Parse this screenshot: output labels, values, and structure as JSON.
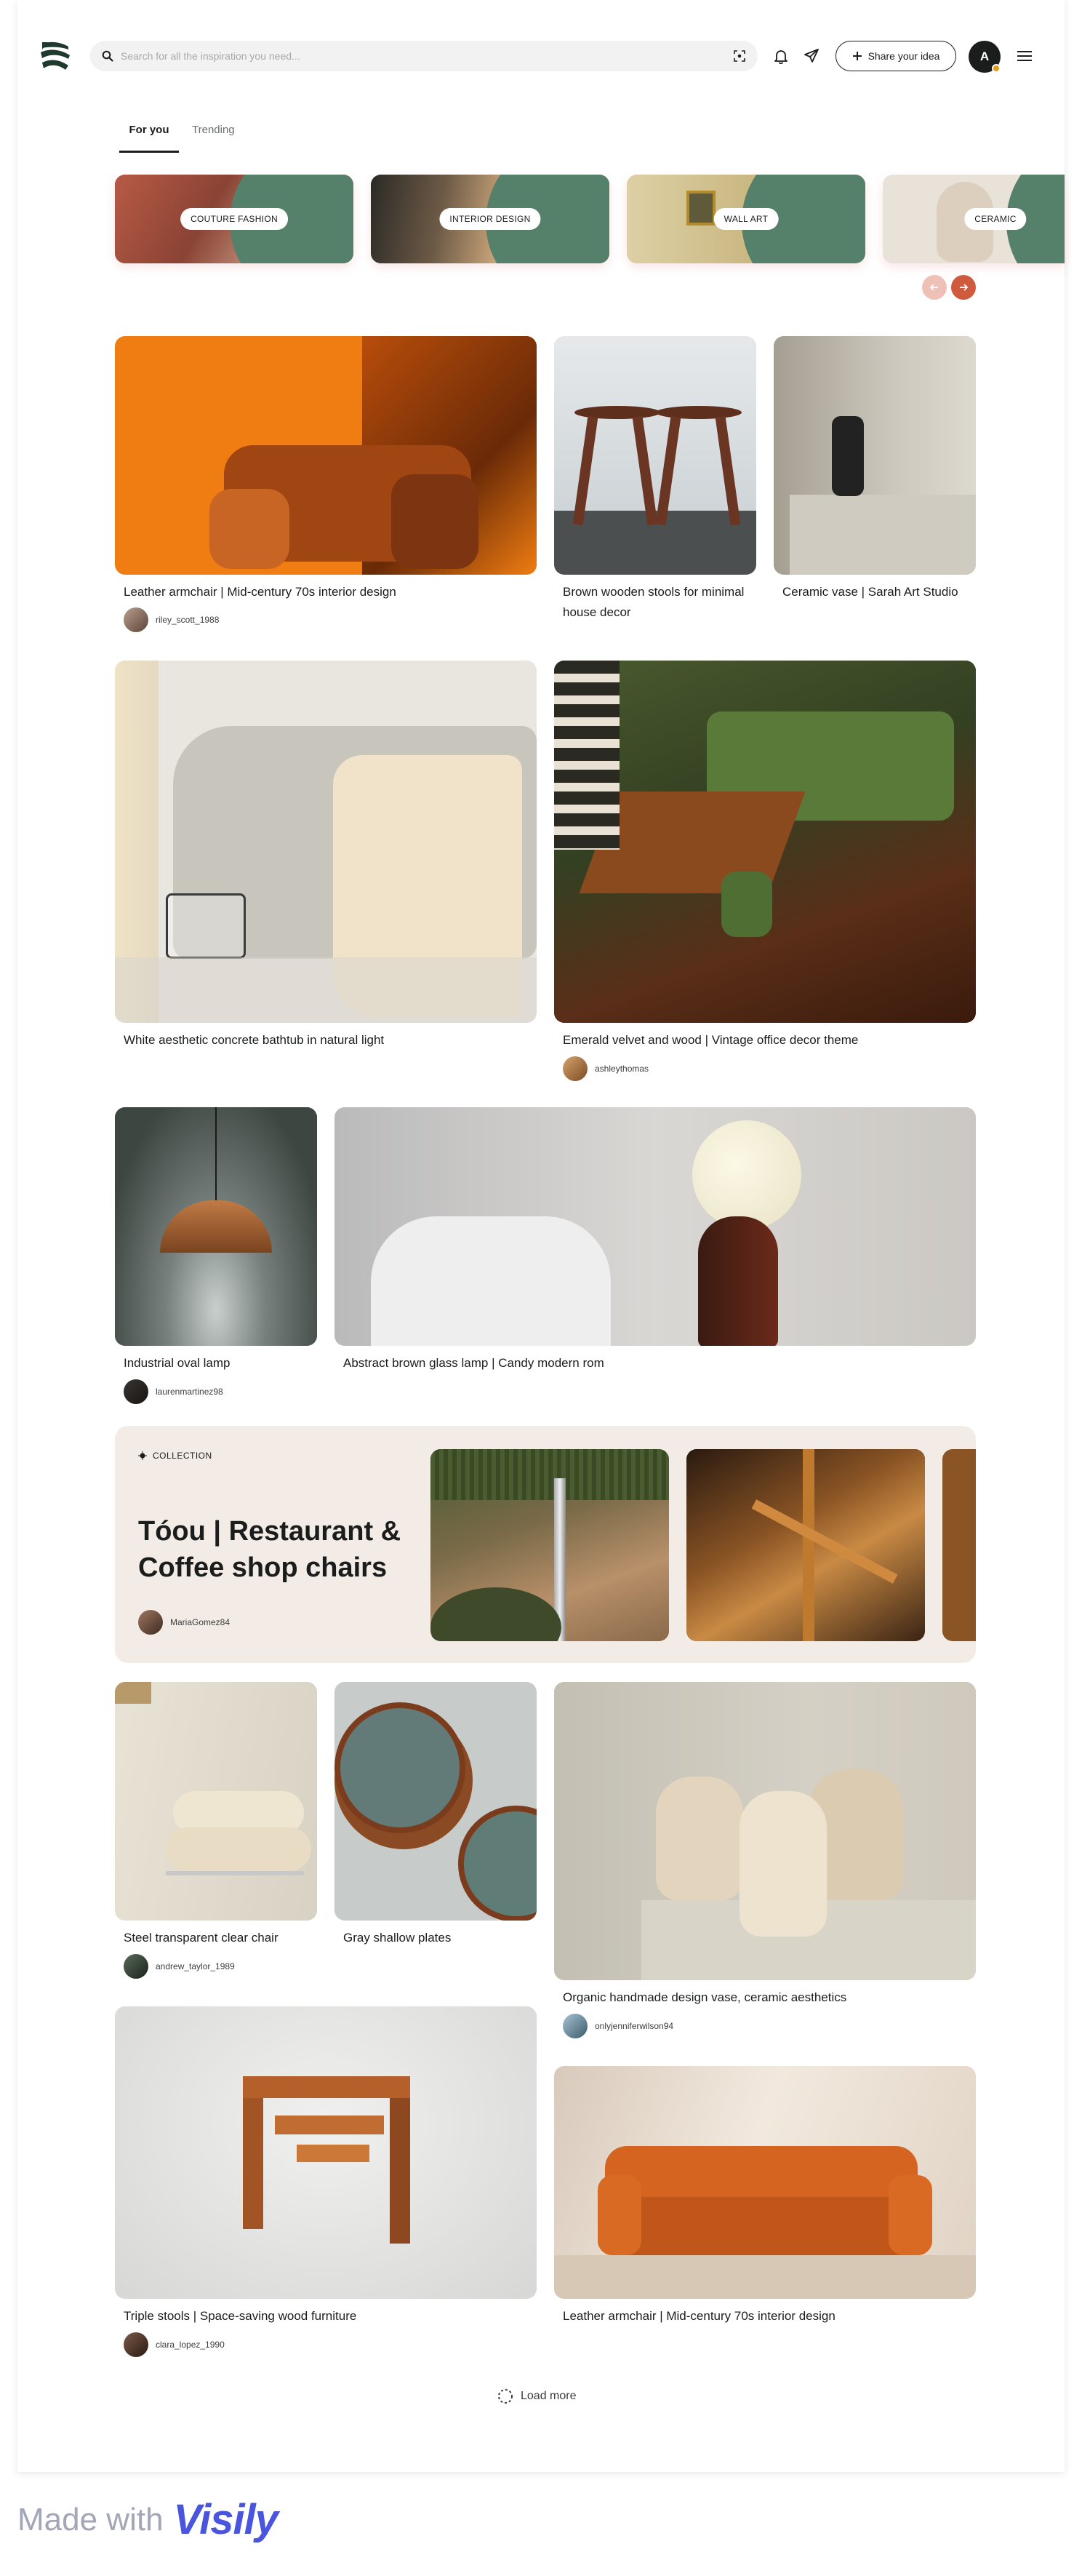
{
  "header": {
    "search_placeholder": "Search for all the inspiration you need...",
    "share_label": "Share your idea",
    "avatar_initial": "A"
  },
  "tabs": [
    {
      "label": "For you",
      "active": true
    },
    {
      "label": "Trending",
      "active": false
    }
  ],
  "categories": [
    {
      "label": "COUTURE FASHION"
    },
    {
      "label": "INTERIOR DESIGN"
    },
    {
      "label": "WALL ART"
    },
    {
      "label": "CERAMIC"
    }
  ],
  "feed": [
    {
      "title": "Leather armchair | Mid-century 70s interior design",
      "user": "riley_scott_1988"
    },
    {
      "title": "Brown wooden stools for minimal house decor"
    },
    {
      "title": "Ceramic vase | Sarah Art Studio"
    },
    {
      "title": "White aesthetic concrete bathtub in natural light"
    },
    {
      "title": "Emerald velvet and wood | Vintage office decor theme",
      "user": "ashleythomas"
    },
    {
      "title": "Industrial oval lamp",
      "user": "laurenmartinez98"
    },
    {
      "title": "Abstract brown glass lamp | Candy modern rom"
    },
    {
      "title": "Steel transparent clear chair",
      "user": "andrew_taylor_1989"
    },
    {
      "title": "Gray shallow plates"
    },
    {
      "title": "Organic handmade design vase, ceramic aesthetics",
      "user": "onlyjenniferwilson94"
    },
    {
      "title": "Triple stools | Space-saving wood furniture",
      "user": "clara_lopez_1990"
    },
    {
      "title": "Leather armchair | Mid-century 70s interior design"
    }
  ],
  "collection": {
    "tag": "COLLECTION",
    "title": "Tóou | Restaurant & Coffee shop chairs",
    "user": "MariaGomez84"
  },
  "load_more": "Load more",
  "footer": {
    "made_with": "Made with",
    "brand": "Visily"
  },
  "colors": {
    "accent": "#cf5a3e",
    "green": "#55806a",
    "dark": "#1b1d1c"
  }
}
